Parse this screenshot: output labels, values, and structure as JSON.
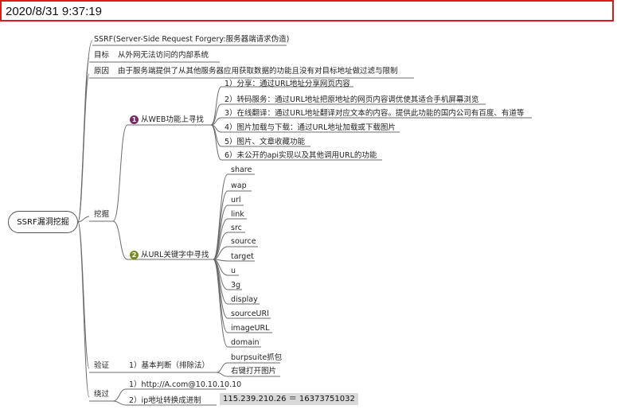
{
  "timestamp": "2020/8/31 9:37:19",
  "root": "SSRF漏洞挖掘",
  "title_node": "SSRF(Server-Side Request Forgery:服务器端请求伪造)",
  "goal": {
    "label": "目标",
    "text": "从外网无法访问的内部系统"
  },
  "cause": {
    "label": "原因",
    "text": "由于服务端提供了从其他服务器应用获取数据的功能且没有对目标地址做过滤与限制"
  },
  "mining": {
    "label": "挖掘",
    "web": {
      "badge": "1",
      "label": "从WEB功能上寻找",
      "items": [
        "1）分享：通过URL地址分享网页内容",
        "2）转码服务：通过URL地址把原地址的网页内容调优使其适合手机屏幕浏览",
        "3）在线翻译：通过URL地址翻译对应文本的内容。提供此功能的国内公司有百度、有道等",
        "4）图片加载与下载：通过URL地址加载或下载图片",
        "5）图片、文章收藏功能",
        "6）未公开的api实现以及其他调用URL的功能"
      ]
    },
    "keywords": {
      "badge": "2",
      "label": "从URL关键字中寻找",
      "items": [
        "share",
        "wap",
        "url",
        "link",
        "src",
        "source",
        "target",
        "u",
        "3g",
        "display",
        "sourceURl",
        "imageURL",
        "domain"
      ]
    }
  },
  "verify": {
    "label": "验证",
    "method": "1）基本判断（排除法）",
    "items": [
      "burpsuite抓包",
      "右键打开图片"
    ]
  },
  "bypass": {
    "label": "绕过",
    "item1": "1）http://A.com@10.10.10.10",
    "item2": "2）ip地址转换成进制",
    "conversion": "115.239.210.26 ＝ 16373751032"
  }
}
